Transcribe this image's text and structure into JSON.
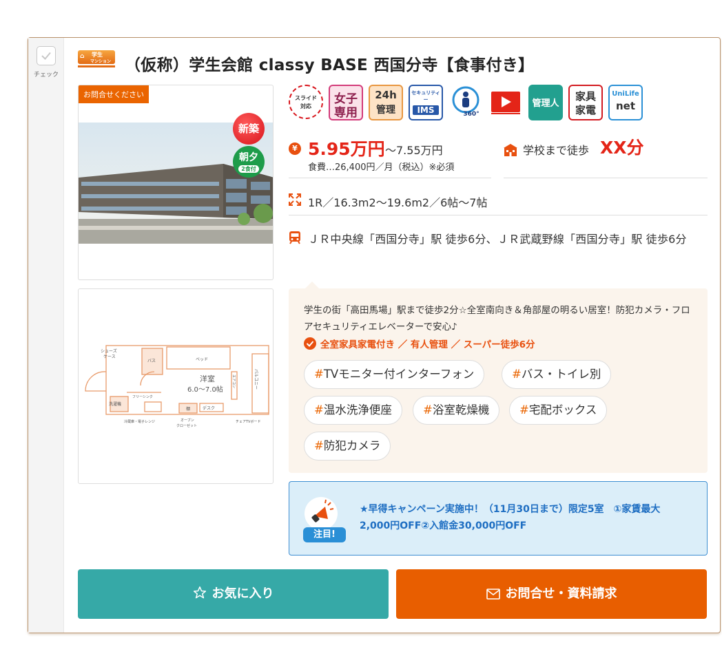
{
  "check": {
    "label": "チェック"
  },
  "logo": {
    "line1": "学生",
    "line2": "マンション"
  },
  "property": {
    "title": "（仮称）学生会館 classy BASE 西国分寺【食事付き】",
    "photo_tag": "お問合せください",
    "badge_new": "新築",
    "badge_meal_main": "朝夕",
    "badge_meal_sub": "2食付"
  },
  "icons": [
    {
      "name": "slide-icon",
      "line1": "スライド",
      "line2": "対応"
    },
    {
      "name": "women-only-icon",
      "line1": "女子",
      "line2": "専用"
    },
    {
      "name": "24h-icon",
      "line1": "24h",
      "line2": "管理"
    },
    {
      "name": "security-icon",
      "line1": "セキュリティー",
      "line2": "IMS"
    },
    {
      "name": "360-icon",
      "line1": "360°"
    },
    {
      "name": "video-icon"
    },
    {
      "name": "manager-icon",
      "line1": "管理人"
    },
    {
      "name": "furniture-icon",
      "line1": "家具",
      "line2": "家電"
    },
    {
      "name": "unilife-icon",
      "line1": "UniLife",
      "line2": "net"
    }
  ],
  "price": {
    "yen": "¥",
    "main": "5.95万円",
    "rest": "～7.55万円",
    "meal_note": "食費…26,400円／月（税込）※必須"
  },
  "walk": {
    "label": "学校まで徒歩",
    "value": "XX分"
  },
  "room": {
    "text": "1R／16.3m2～19.6m2／6帖～7帖"
  },
  "station": {
    "text": "ＪＲ中央線「西国分寺」駅 徒歩6分、ＪＲ武蔵野線「西国分寺」駅 徒歩6分"
  },
  "floorplan": {
    "shoes": "シューズ",
    "case": "ケース",
    "bath": "バス",
    "bed": "ベッド",
    "room": "洋室",
    "size": "6.0～7.0帖",
    "flooring": "フリーシンク",
    "laundry": "洗濯機",
    "desk": "デスク",
    "balcony": "バルコニー",
    "aircon": "エアコン",
    "fridge": "冷蔵庫・電子レンジ",
    "oven": "オーブン",
    "closet": "クローゼット",
    "chair": "チェアTVボード",
    "shelf": "棚"
  },
  "description": {
    "text": "学生の街「高田馬場」駅まで徒歩2分☆全室南向き＆角部屋の明るい居室！防犯カメラ・フロアセキュリティエレベーターで安心♪",
    "feature": "全室家具家電付き ／ 有人管理 ／ スーパー徒歩6分",
    "tags": [
      "TVモニター付インターフォン",
      "バス・トイレ別",
      "温水洗浄便座",
      "浴室乾燥機",
      "宅配ボックス",
      "防犯カメラ"
    ],
    "hash": "#"
  },
  "campaign": {
    "badge": "注目!",
    "text": "★早得キャンペーン実施中！（11月30日まで）限定5室　①家賃最大2,000円OFF②入館金30,000円OFF"
  },
  "buttons": {
    "favorite": "お気に入り",
    "inquiry": "お問合せ・資料請求"
  },
  "colors": {
    "accent": "#ea6400",
    "price": "#e42518",
    "teal": "#36a9a7",
    "campaign": "#1e6ec2"
  }
}
